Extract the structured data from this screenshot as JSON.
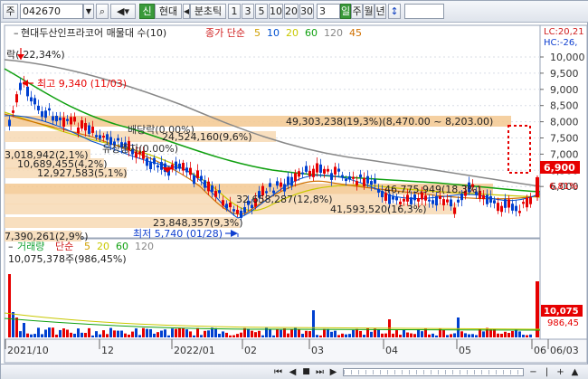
{
  "toolbar": {
    "market_label": "주",
    "code_value": "042670",
    "sin_label": "신",
    "hyeondae_label": "현대",
    "period_unit": "분초틱",
    "intervals": [
      "1",
      "3",
      "5",
      "10",
      "20",
      "30"
    ],
    "count_value": "3",
    "period_buttons": [
      "일",
      "주",
      "월",
      "년"
    ],
    "scroll_arrow": "↕"
  },
  "price_panel": {
    "title": "현대두산인프라코어 매물대 수(10)",
    "legend_label": "종가 단순",
    "ma_legend": [
      {
        "label": "5",
        "color": "#d0a000"
      },
      {
        "label": "10",
        "color": "#0050d0"
      },
      {
        "label": "20",
        "color": "#c8c800"
      },
      {
        "label": "60",
        "color": "#10a010"
      },
      {
        "label": "120",
        "color": "#888888"
      },
      {
        "label": "45",
        "color": "#d07000"
      }
    ],
    "lc_label": "LC:20,21",
    "hc_label": "HC:-26,",
    "drop_label": "락(-22,34%)",
    "high_label": "최고 9,340 (11/03)",
    "low_label": "최저 5,740 (01/28)",
    "dividend_label": "배당락(0.00%)",
    "capital_label": "유상증자(0.00%)",
    "volume_profile_labels": [
      {
        "text": "49,303,238(19,3%)(8,470.00 ~ 8,203.00)",
        "row": 1
      },
      {
        "text": "24,524,160(9,6%)",
        "row": 2
      },
      {
        "text": "3,018,942(2,1%)",
        "row": 3
      },
      {
        "text": "10,689,455(4,2%)",
        "row": 4
      },
      {
        "text": "12,927,583(5,1%)",
        "row": 5
      },
      {
        "text": "46,775,949(18,3%)",
        "row": 6
      },
      {
        "text": "32,658,287(12,8%)",
        "row": 7
      },
      {
        "text": "41,593,520(16,3%)",
        "row": 8
      },
      {
        "text": "23,848,357(9,3%)",
        "row": 9
      },
      {
        "text": "7,390,261(2,9%)",
        "row": 10
      }
    ],
    "y_ticks": [
      "10,000",
      "9,500",
      "9,000",
      "8,500",
      "8,000",
      "7,500",
      "7,000",
      "6,500",
      "6,000"
    ],
    "current_price": "6,900",
    "current_pct": "6,81%"
  },
  "volume_panel": {
    "title": "거래량",
    "legend_label": "단순",
    "ma_legend": [
      {
        "label": "5",
        "color": "#d0a000"
      },
      {
        "label": "20",
        "color": "#c8c800"
      },
      {
        "label": "60",
        "color": "#10a010"
      },
      {
        "label": "120",
        "color": "#888888"
      }
    ],
    "max_label": "10,075,378주(986,45%)",
    "current_volume": "10,075",
    "current_pct": "986,45"
  },
  "x_axis": {
    "labels": [
      "2021/10",
      "12",
      "2022/01",
      "02",
      "03",
      "04",
      "05",
      "06",
      "06/03"
    ]
  },
  "bottom_toolbar": {
    "buttons": [
      "⏮",
      "◀",
      "■",
      "⏭",
      "▶",
      "⏹",
      "−",
      "|",
      "+",
      "▲"
    ]
  },
  "colors": {
    "up": "#e60000",
    "down": "#0040d0",
    "profile": "#f7d9b4",
    "profile_max": "#f3c891",
    "grid": "#d8dde6"
  }
}
